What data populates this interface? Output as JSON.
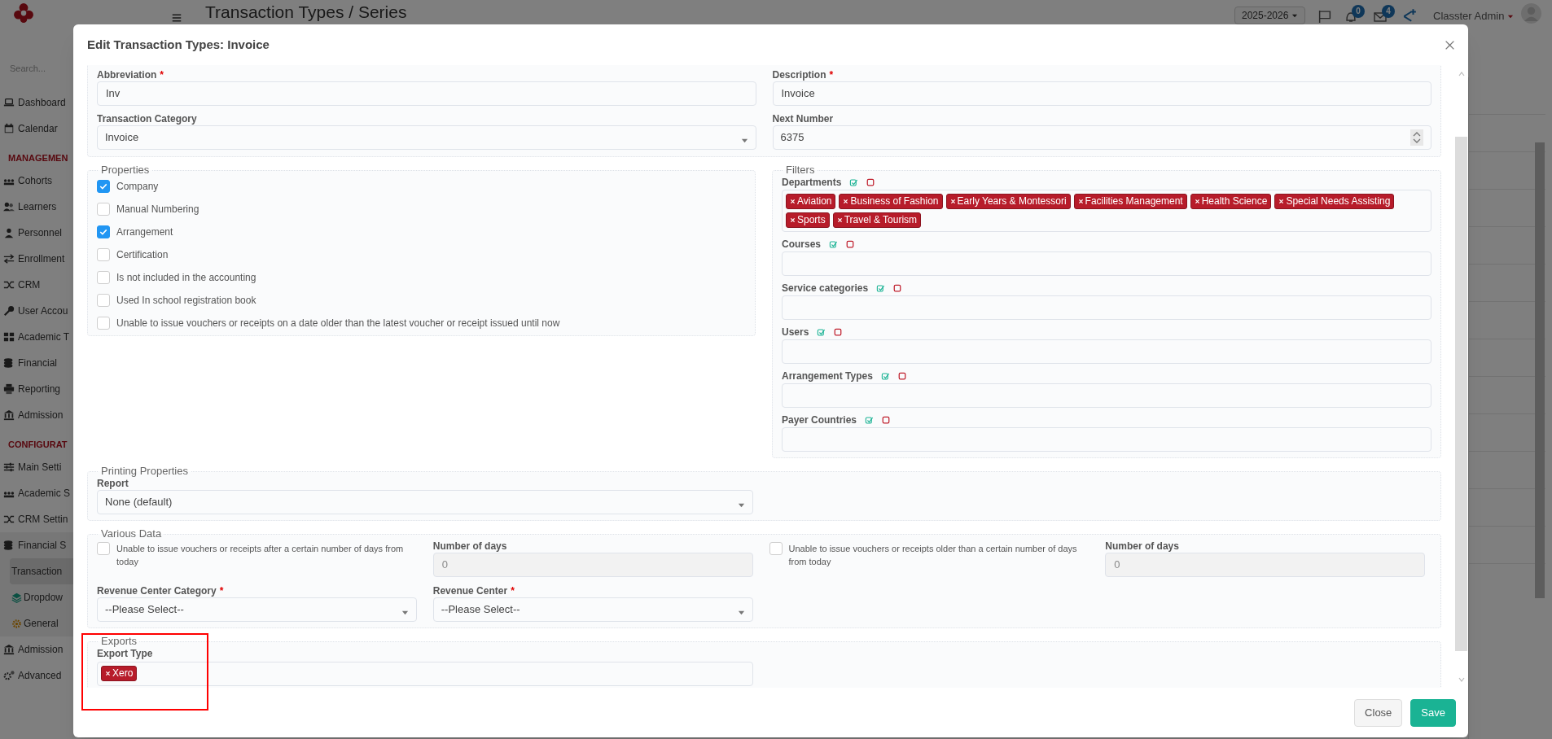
{
  "app": {
    "search_placeholder": "Search...",
    "page_title": "Transaction Types / Series",
    "year": "2025-2026",
    "notifications": "0",
    "messages": "4",
    "user": "Classter Admin"
  },
  "sidebar": {
    "items": [
      {
        "kind": "item",
        "label": "Dashboard",
        "selected": false
      },
      {
        "kind": "item",
        "label": "Calendar",
        "selected": false
      },
      {
        "kind": "section",
        "label": "MANAGEMEN"
      },
      {
        "kind": "item",
        "label": "Cohorts",
        "selected": false
      },
      {
        "kind": "item",
        "label": "Learners",
        "selected": false
      },
      {
        "kind": "item",
        "label": "Personnel",
        "selected": false
      },
      {
        "kind": "item",
        "label": "Enrollment",
        "selected": false
      },
      {
        "kind": "item",
        "label": "CRM",
        "selected": false
      },
      {
        "kind": "item",
        "label": "User Accou",
        "selected": false
      },
      {
        "kind": "item",
        "label": "Academic T",
        "selected": false
      },
      {
        "kind": "item",
        "label": "Financial",
        "selected": false
      },
      {
        "kind": "item",
        "label": "Reporting",
        "selected": false
      },
      {
        "kind": "item",
        "label": "Admission",
        "selected": false
      },
      {
        "kind": "section",
        "label": "CONFIGURAT"
      },
      {
        "kind": "item",
        "label": "Main Setti",
        "selected": false
      },
      {
        "kind": "item",
        "label": "Academic S",
        "selected": false
      },
      {
        "kind": "item",
        "label": "CRM Settin",
        "selected": false
      },
      {
        "kind": "item",
        "label": "Financial S",
        "selected": false,
        "expanded": true,
        "children": [
          {
            "label": "Transaction",
            "selected": true
          },
          {
            "label": "Dropdow",
            "selected": false
          },
          {
            "label": "General",
            "selected": false
          }
        ]
      },
      {
        "kind": "item",
        "label": "Admission",
        "selected": false
      },
      {
        "kind": "item",
        "label": "Advanced",
        "selected": false
      }
    ]
  },
  "modal": {
    "title": "Edit Transaction Types: Invoice",
    "main_fields": [
      {
        "kind": "text",
        "label": "Abbreviation",
        "required_mark": "*",
        "value": "Inv"
      },
      {
        "kind": "text",
        "label": "Description",
        "required_mark": "*",
        "value": "Invoice"
      },
      {
        "kind": "select",
        "label": "Transaction Category",
        "value": "Invoice"
      },
      {
        "kind": "number",
        "label": "Next Number",
        "value": "6375"
      }
    ],
    "properties": {
      "legend": "Properties",
      "options": [
        {
          "label": "Company",
          "checked": true
        },
        {
          "label": "Manual Numbering",
          "checked": false
        },
        {
          "label": "Arrangement",
          "checked": true
        },
        {
          "label": "Certification",
          "checked": false
        },
        {
          "label": "Is not included in the accounting",
          "checked": false
        },
        {
          "label": "Used In school registration book",
          "checked": false
        },
        {
          "label": "Unable to issue vouchers or receipts on a date older than the latest voucher or receipt issued until now",
          "checked": false
        }
      ]
    },
    "filters": {
      "legend": "Filters",
      "groups": [
        {
          "label": "Departments",
          "tags": [
            "Aviation",
            "Business of Fashion",
            "Early Years & Montessori",
            "Facilities Management",
            "Health Science",
            "Special Needs Assisting",
            "Sports",
            "Travel & Tourism"
          ]
        },
        {
          "label": "Courses"
        },
        {
          "label": "Service categories"
        },
        {
          "label": "Users"
        },
        {
          "label": "Arrangement Types"
        },
        {
          "label": "Payer Countries"
        }
      ]
    },
    "printing": {
      "legend": "Printing Properties",
      "fields": [
        {
          "kind": "select",
          "label": "Report",
          "value": "None (default)"
        }
      ]
    },
    "various": {
      "legend": "Various Data",
      "fields": [
        {
          "kind": "checkbox",
          "label": "Unable to issue vouchers or receipts after a certain number of days from today",
          "checked": false
        },
        {
          "kind": "text",
          "label": "Number of days",
          "value": "0",
          "disabled": true
        },
        {
          "kind": "checkbox",
          "label": "Unable to issue vouchers or receipts older than a certain number of days from today",
          "checked": false
        },
        {
          "kind": "text",
          "label": "Number of days",
          "value": "0",
          "disabled": true
        },
        {
          "kind": "select",
          "label": "Revenue Center Category",
          "required_mark": "*",
          "value": "--Please Select--"
        },
        {
          "kind": "select",
          "label": "Revenue Center",
          "required_mark": "*",
          "value": "--Please Select--"
        }
      ]
    },
    "exports": {
      "legend": "Exports",
      "label": "Export Type",
      "tags": [
        "Xero"
      ]
    },
    "annotations": [
      {
        "kind": "highlight-box"
      }
    ],
    "buttons": [
      {
        "kind": "secondary",
        "label": "Close"
      },
      {
        "kind": "primary",
        "label": "Save"
      }
    ]
  }
}
